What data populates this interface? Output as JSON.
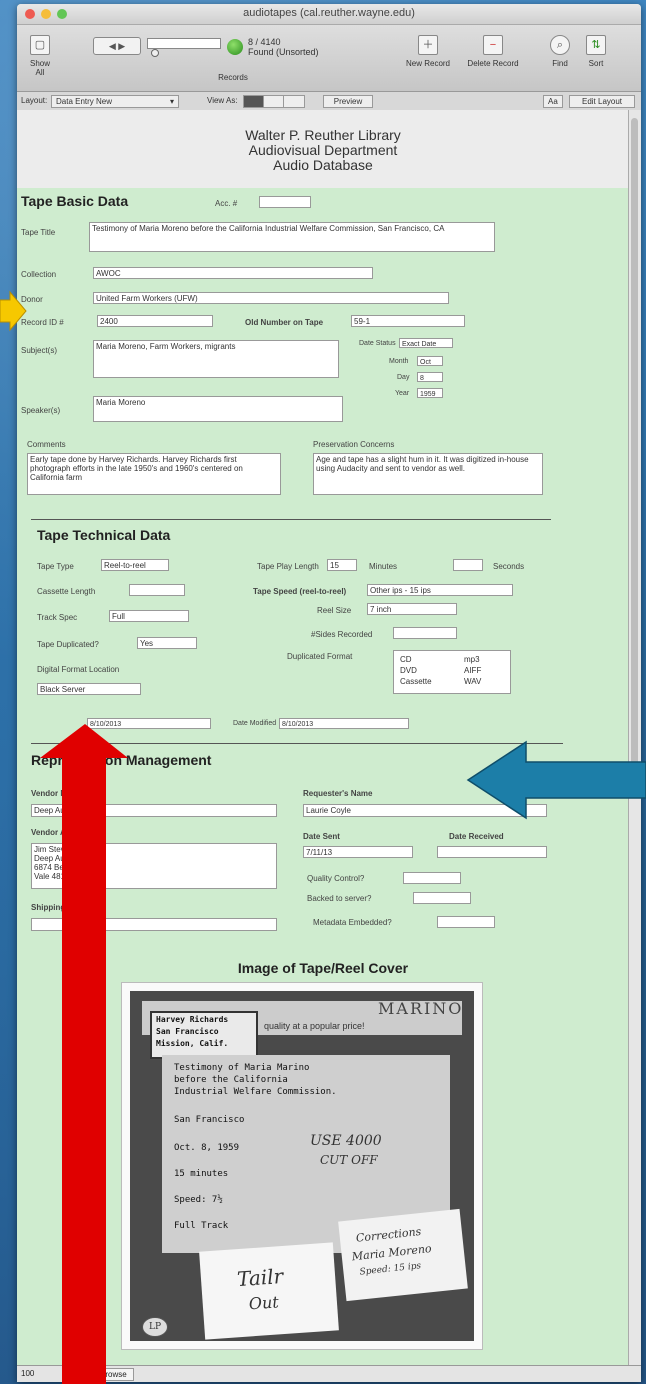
{
  "window": {
    "title": "audiotapes (cal.reuther.wayne.edu)"
  },
  "toolbar": {
    "show_all": "Show All",
    "records_label": "Records",
    "record_count": "8 / 4140",
    "found_status": "Found (Unsorted)",
    "new_record": "New Record",
    "delete_record": "Delete Record",
    "find": "Find",
    "sort": "Sort"
  },
  "layoutbar": {
    "layout_label": "Layout:",
    "layout_value": "Data Entry New",
    "view_as": "View As:",
    "preview": "Preview",
    "font_size": "Aa",
    "edit_layout": "Edit Layout"
  },
  "header": {
    "line1": "Walter P. Reuther Library",
    "line2": "Audiovisual Department",
    "line3": "Audio Database"
  },
  "basic": {
    "section_title": "Tape Basic Data",
    "acc_label": "Acc. #",
    "acc_value": "",
    "tape_title_label": "Tape Title",
    "tape_title_value": "Testimony of Maria Moreno before the California Industrial Welfare Commission, San Francisco, CA",
    "collection_label": "Collection",
    "collection_value": "AWOC",
    "donor_label": "Donor",
    "donor_value": "United Farm Workers (UFW)",
    "record_id_label": "Record ID #",
    "record_id_value": "2400",
    "old_number_label": "Old Number on Tape",
    "old_number_value": "59-1",
    "subjects_label": "Subject(s)",
    "subjects_value": "Maria Moreno, Farm Workers, migrants",
    "date_status_label": "Date Status",
    "date_status_value": "Exact Date",
    "month_label": "Month",
    "month_value": "Oct",
    "day_label": "Day",
    "day_value": "8",
    "year_label": "Year",
    "year_value": "1959",
    "speakers_label": "Speaker(s)",
    "speakers_value": "Maria Moreno",
    "comments_label": "Comments",
    "comments_value": "Early tape done by Harvey Richards. Harvey Richards first photograph efforts in the late 1950's and 1960's centered on California farm",
    "preservation_label": "Preservation Concerns",
    "preservation_value": "Age and tape has a slight hum in it. It was digitized in-house using Audacity and sent to vendor as well."
  },
  "technical": {
    "section_title": "Tape Technical Data",
    "tape_type_label": "Tape Type",
    "tape_type_value": "Reel-to-reel",
    "play_length_label": "Tape Play Length",
    "play_length_value": "15",
    "minutes_label": "Minutes",
    "seconds_label": "Seconds",
    "cassette_length_label": "Cassette Length",
    "tape_speed_label": "Tape Speed (reel-to-reel)",
    "tape_speed_value": "Other ips - 15 ips",
    "track_spec_label": "Track Spec",
    "track_spec_value": "Full",
    "reel_size_label": "Reel Size",
    "reel_size_value": "7 inch",
    "duplicated_label": "Tape Duplicated?",
    "duplicated_value": "Yes",
    "sides_label": "#Sides Recorded",
    "duplicated_format_label": "Duplicated Format",
    "formats_left": [
      "CD",
      "DVD",
      "Cassette"
    ],
    "formats_right": [
      "mp3",
      "AIFF",
      "WAV"
    ],
    "digital_location_label": "Digital Format Location",
    "digital_location_value": "Black Server",
    "created_value": "8/10/2013",
    "date_modified_label": "Date Modified",
    "date_modified_value": "8/10/2013"
  },
  "reproduction": {
    "section_title": "Reproduction Management",
    "vendor_name_label": "Vendor Name",
    "vendor_name_value": "Deep Audio",
    "vendor_address_label": "Vendor Address",
    "vendor_address_lines": [
      "Jim Stevens",
      "Deep Audio",
      "6874 Beagle Rd.",
      "Vale 48168"
    ],
    "shipping_label": "Shipping Tracking",
    "requester_label": "Requester's Name",
    "requester_value": "Laurie Coyle",
    "date_sent_label": "Date Sent",
    "date_sent_value": "7/11/13",
    "date_received_label": "Date Received",
    "quality_label": "Quality Control?",
    "backed_label": "Backed to server?",
    "metadata_label": "Metadata Embedded?"
  },
  "image_section": {
    "title": "Image of Tape/Reel Cover",
    "box_brand": "MARINO",
    "box_tagline": "quality at a popular price!",
    "label_lines": [
      "Harvey Richards",
      "San Francisco",
      "Mission, Calif."
    ],
    "card_lines": [
      "Testimony of Maria Marino",
      "before the California",
      "Industrial Welfare Commission.",
      "San Francisco",
      "Oct. 8, 1959",
      "15 minutes",
      "Speed: 7½",
      "Full Track"
    ],
    "handwritten_use": "USE 4000",
    "handwritten_cut": "CUT OFF",
    "note_tail": "Tailr",
    "note_out": "Out",
    "note_corrections": "Corrections",
    "note_name": "Maria Moreno",
    "note_speed": "Speed: 15 ips",
    "note_initials": "LP"
  },
  "statusbar": {
    "zoom": "100",
    "mode": "Browse"
  },
  "colors": {
    "form_bg": "#cfeccf",
    "arrow_yellow": "#f6c800",
    "arrow_red": "#e00000",
    "arrow_teal": "#1c7ea8"
  }
}
